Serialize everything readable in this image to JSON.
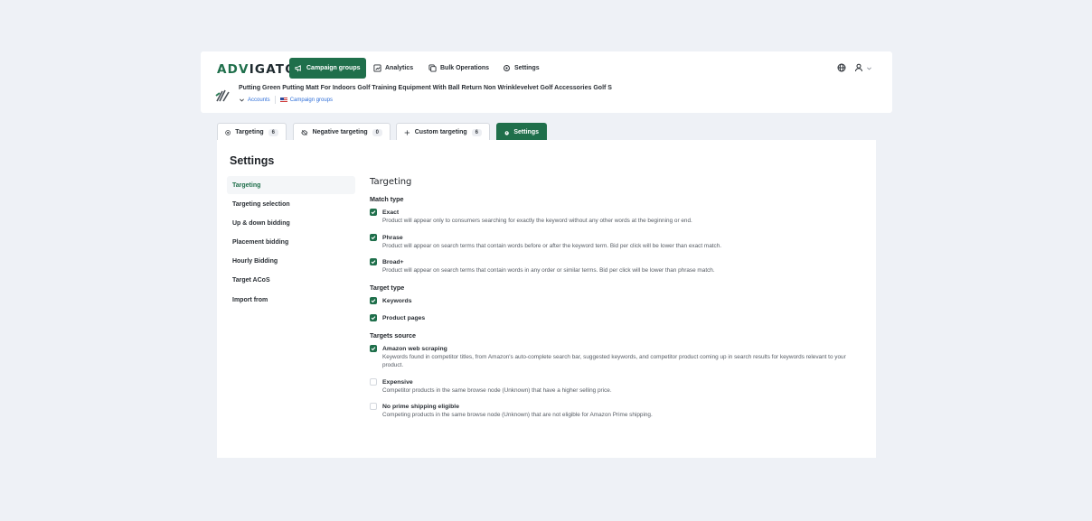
{
  "app": {
    "logo_part1": "ADV",
    "logo_part2": "IGATOR"
  },
  "nav": {
    "items": [
      {
        "label": "Campaign groups",
        "icon": "megaphone-icon",
        "active": true
      },
      {
        "label": "Analytics",
        "icon": "chart-icon"
      },
      {
        "label": "Bulk Operations",
        "icon": "copy-icon"
      },
      {
        "label": "Settings",
        "icon": "gear-icon"
      }
    ]
  },
  "product": {
    "title": "Putting Green Putting Matt For Indoors Golf Training Equipment With Ball Return Non Wrinklevelvet Golf Accessories Golf S",
    "breadcrumb_accounts": "Accounts",
    "breadcrumb_campaign_groups": "Campaign groups"
  },
  "tabs": [
    {
      "label": "Targeting",
      "count": "6",
      "icon": "target-icon"
    },
    {
      "label": "Negative targeting",
      "count": "0",
      "icon": "eye-off-icon"
    },
    {
      "label": "Custom targeting",
      "count": "6",
      "icon": "plus-icon"
    },
    {
      "label": "Settings",
      "icon": "gear-icon",
      "active": true
    }
  ],
  "panel": {
    "title": "Settings",
    "sidebar": [
      {
        "label": "Targeting",
        "active": true
      },
      {
        "label": "Targeting selection"
      },
      {
        "label": "Up & down bidding"
      },
      {
        "label": "Placement bidding"
      },
      {
        "label": "Hourly Bidding"
      },
      {
        "label": "Target ACoS"
      },
      {
        "label": "Import from"
      }
    ]
  },
  "content": {
    "section_title": "Targeting",
    "match_type": {
      "title": "Match type",
      "options": [
        {
          "label": "Exact",
          "desc": "Product will appear only to consumers searching for exactly the keyword without any other words at the beginning or end.",
          "checked": true
        },
        {
          "label": "Phrase",
          "desc": "Product will appear on search terms that contain words before or after the keyword term. Bid per click will be lower than exact match.",
          "checked": true
        },
        {
          "label": "Broad+",
          "desc": "Product will appear on search terms that contain words in any order or similar terms. Bid per click will be lower than phrase match.",
          "checked": true
        }
      ]
    },
    "target_type": {
      "title": "Target type",
      "options": [
        {
          "label": "Keywords",
          "checked": true
        },
        {
          "label": "Product pages",
          "checked": true
        }
      ]
    },
    "targets_source": {
      "title": "Targets source",
      "options": [
        {
          "label": "Amazon web scraping",
          "desc": "Keywords found in competitor titles, from Amazon's auto-complete search bar, suggested keywords, and competitor product coming up in search results for keywords relevant to your product.",
          "checked": true
        },
        {
          "label": "Expensive",
          "desc": "Competitor products in the same browse node (Unknown) that have a higher selling price.",
          "checked": false
        },
        {
          "label": "No prime shipping eligible",
          "desc": "Competing products in the same browse node (Unknown) that are not eligible for Amazon Prime shipping.",
          "checked": false
        }
      ]
    }
  },
  "colors": {
    "accent": "#1f6f4b",
    "background": "#eef1f6"
  }
}
